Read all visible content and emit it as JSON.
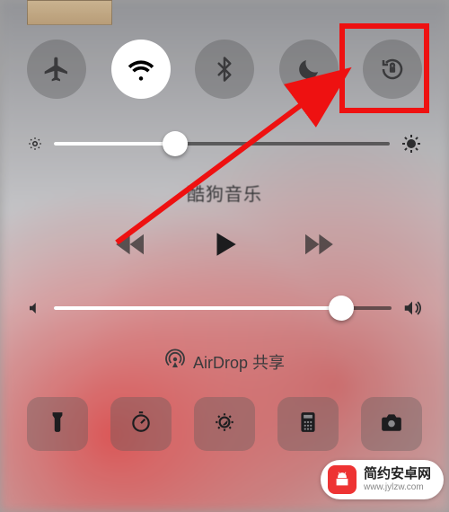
{
  "toggles": {
    "airplane": {
      "name": "airplane-mode-toggle"
    },
    "wifi": {
      "name": "wifi-toggle",
      "active": true
    },
    "bluetooth": {
      "name": "bluetooth-toggle"
    },
    "dnd": {
      "name": "do-not-disturb-toggle"
    },
    "orientation_lock": {
      "name": "orientation-lock-toggle"
    }
  },
  "brightness": {
    "value_pct": 36
  },
  "now_playing": {
    "app_label": "酷狗音乐"
  },
  "media": {
    "prev": "previous-track-button",
    "play": "play-button",
    "next": "next-track-button"
  },
  "volume": {
    "value_pct": 85
  },
  "airdrop": {
    "label": "AirDrop 共享"
  },
  "shortcuts": {
    "flashlight": "flashlight-button",
    "timer": "timer-button",
    "nightshift": "night-shift-button",
    "calculator": "calculator-button",
    "camera": "camera-button"
  },
  "annotation": {
    "highlight_target": "orientation-lock-toggle",
    "highlight_color": "#ee1111"
  },
  "watermark": {
    "title": "简约安卓网",
    "url": "www.jylzw.com"
  }
}
